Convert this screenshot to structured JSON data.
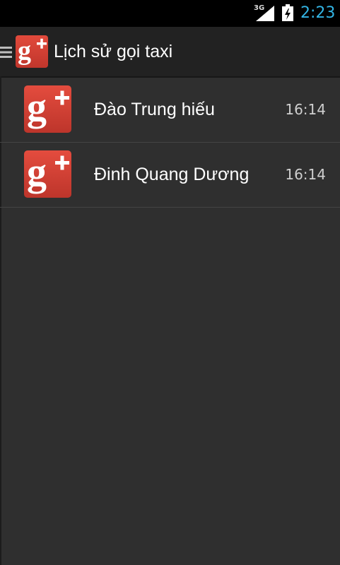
{
  "status_bar": {
    "network": "3G",
    "signal_icon": "cell-signal-icon",
    "battery_icon": "battery-charging-icon",
    "time": "2:23",
    "time_color": "#33b5e5"
  },
  "action_bar": {
    "drawer_icon": "menu-drawer-icon",
    "logo_icon": "google-plus-icon",
    "title": "Lịch sử gọi taxi"
  },
  "calls": [
    {
      "name": "Đào Trung hiếu",
      "time": "16:14",
      "avatar_icon": "google-plus-icon"
    },
    {
      "name": "Đinh Quang Dương",
      "time": "16:14",
      "avatar_icon": "google-plus-icon"
    }
  ],
  "colors": {
    "background": "#2f2f2f",
    "action_bar": "#222222",
    "brand_red": "#d73d32"
  }
}
